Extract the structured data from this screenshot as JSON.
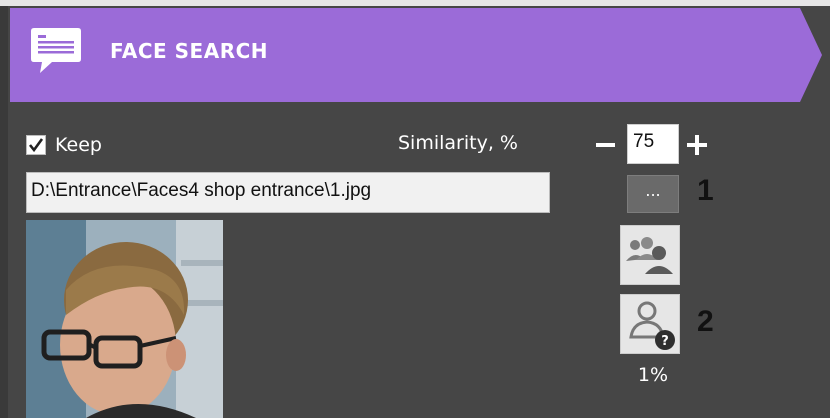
{
  "header": {
    "title": "FACE SEARCH",
    "icon": "face-search-icon",
    "accent": "#9b6bd8"
  },
  "keep": {
    "label": "Keep",
    "checked": true
  },
  "similarity": {
    "label": "Similarity, %",
    "value": "75",
    "decrease_icon": "minus-icon",
    "increase_icon": "plus-icon"
  },
  "file": {
    "path": "D:\\Entrance\\Faces4 shop entrance\\1.jpg",
    "browse_label": "..."
  },
  "buttons": {
    "search_icon": "group-search-icon",
    "unknown_icon": "unknown-person-icon"
  },
  "result": {
    "percent": "1%"
  },
  "callouts": {
    "one": "1",
    "two": "2"
  }
}
